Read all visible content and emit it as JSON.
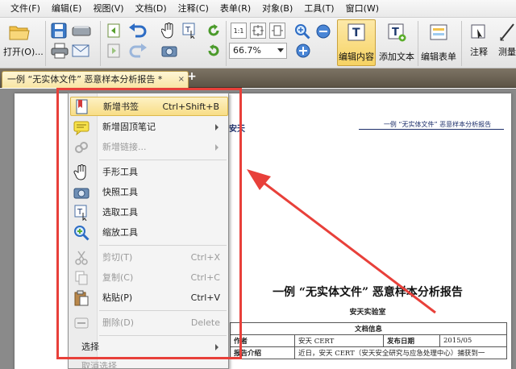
{
  "menubar": {
    "items": [
      "文件(F)",
      "编辑(E)",
      "视图(V)",
      "文档(D)",
      "注释(C)",
      "表单(R)",
      "对象(B)",
      "工具(T)",
      "窗口(W)"
    ]
  },
  "toolbar": {
    "open_label": "打开(O)...",
    "zoom_value": "66.7%",
    "edit_content_label": "编辑内容",
    "add_text_label": "添加文本",
    "edit_form_label": "编辑表单",
    "annotate_label": "注释",
    "measure_label": "测量"
  },
  "tabs": {
    "doc_tab_label": "一例 “无实体文件” 恶意样本分析报告 *",
    "close_glyph": "×",
    "add_glyph": "+"
  },
  "context_menu": {
    "items": [
      {
        "label": "新增书签",
        "shortcut": "Ctrl+Shift+B",
        "icon": "bookmark-icon",
        "state": "highlighted",
        "submenu": false
      },
      {
        "label": "新增固顶笔记",
        "shortcut": "",
        "icon": "sticky-note-icon",
        "state": "enabled",
        "submenu": true
      },
      {
        "label": "新增链接...",
        "shortcut": "",
        "icon": "link-icon",
        "state": "disabled",
        "submenu": true
      },
      {
        "label": "手形工具",
        "shortcut": "",
        "icon": "hand-icon",
        "state": "enabled",
        "submenu": false
      },
      {
        "label": "快照工具",
        "shortcut": "",
        "icon": "camera-icon",
        "state": "enabled",
        "submenu": false
      },
      {
        "label": "选取工具",
        "shortcut": "",
        "icon": "select-text-icon",
        "state": "enabled",
        "submenu": false
      },
      {
        "label": "缩放工具",
        "shortcut": "",
        "icon": "zoom-icon",
        "state": "enabled",
        "submenu": false
      },
      {
        "label": "剪切(T)",
        "shortcut": "Ctrl+X",
        "icon": "scissors-icon",
        "state": "disabled",
        "submenu": false
      },
      {
        "label": "复制(C)",
        "shortcut": "Ctrl+C",
        "icon": "copy-icon",
        "state": "disabled",
        "submenu": false
      },
      {
        "label": "粘贴(P)",
        "shortcut": "Ctrl+V",
        "icon": "paste-icon",
        "state": "enabled",
        "submenu": false
      },
      {
        "label": "删除(D)",
        "shortcut": "Delete",
        "icon": "delete-icon",
        "state": "disabled",
        "submenu": false
      },
      {
        "label": "选择",
        "shortcut": "",
        "icon": "",
        "state": "enabled",
        "submenu": true
      },
      {
        "label": "取消选择",
        "shortcut": "",
        "icon": "",
        "state": "disabled",
        "submenu": false
      }
    ]
  },
  "document": {
    "logo_text": "安天",
    "header_title": "一例 “无实体文件” 恶意样本分析报告",
    "title": "一例 “无实体文件” 恶意样本分析报告",
    "subtitle": "安天实验室",
    "table": {
      "section_title": "文档信息",
      "row1": {
        "label": "作者",
        "value": "安天 CERT",
        "label2": "发布日期",
        "value2": "2015/05"
      },
      "row2": {
        "label": "报告介绍",
        "value": "近日，安天 CERT（安天安全研究与应急处理中心）捕获到一"
      }
    }
  },
  "colors": {
    "highlight_box": "#e8403a",
    "menu_highlight": "#f8dd86",
    "tab_bar": "#5c5446"
  }
}
